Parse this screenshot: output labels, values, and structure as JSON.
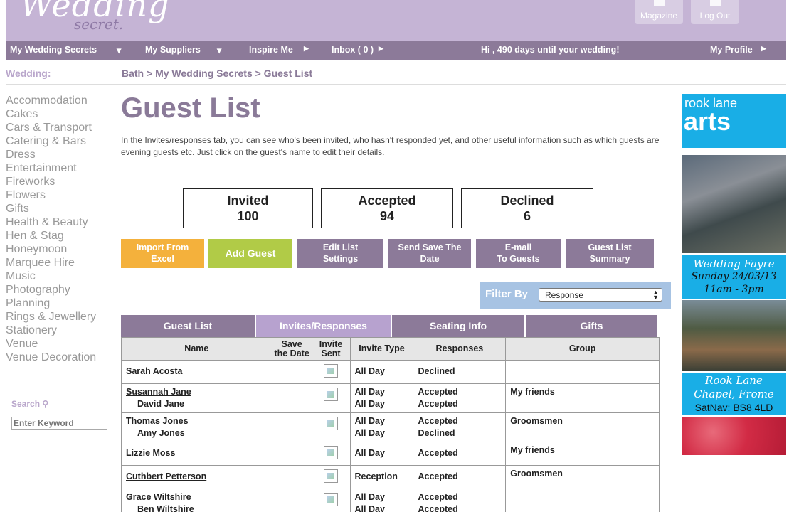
{
  "header": {
    "logo_main": "Wedding",
    "logo_sub": "secret.",
    "magazine": "Magazine",
    "logout": "Log Out"
  },
  "nav": {
    "my_wedding_secrets": "My Wedding Secrets",
    "my_suppliers": "My Suppliers",
    "inspire_me": "Inspire Me",
    "inbox": "Inbox ( 0 )",
    "greeting": "Hi , 490 days until your wedding!",
    "my_profile": "My Profile"
  },
  "sidebar": {
    "wedding_label": "Wedding:",
    "categories": [
      "Accommodation",
      "Cakes",
      "Cars & Transport",
      "Catering & Bars",
      "Dress",
      "Entertainment",
      "Fireworks",
      "Flowers",
      "Gifts",
      "Health & Beauty",
      "Hen & Stag",
      "Honeymoon",
      "Marquee Hire",
      "Music",
      "Photography",
      "Planning",
      "Rings & Jewellery",
      "Stationery",
      "Venue",
      "Venue Decoration"
    ],
    "search_label": "Search",
    "search_placeholder": "Enter Keyword"
  },
  "breadcrumb": "Bath > My Wedding Secrets > Guest List",
  "page": {
    "title": "Guest List",
    "intro": "In the Invites/responses tab, you can see who's been invited, who hasn't responded yet, and other useful information such as which guests are evening guests etc. Just click on the guest's name to edit their details."
  },
  "stats": {
    "invited_label": "Invited",
    "invited_value": "100",
    "accepted_label": "Accepted",
    "accepted_value": "94",
    "declined_label": "Declined",
    "declined_value": "6"
  },
  "actions": {
    "import_1": "Import From",
    "import_2": "Excel",
    "add_guest": "Add Guest",
    "edit_1": "Edit List",
    "edit_2": "Settings",
    "save_1": "Send Save The",
    "save_2": "Date",
    "email_1": "E-mail",
    "email_2": "To Guests",
    "summary_1": "Guest List",
    "summary_2": "Summary"
  },
  "filter": {
    "label": "Filter By",
    "selected": "Response"
  },
  "tabs": {
    "guest_list": "Guest List",
    "invites": "Invites/Responses",
    "seating": "Seating Info",
    "gifts": "Gifts"
  },
  "table": {
    "h_name": "Name",
    "h_save_1": "Save",
    "h_save_2": "the Date",
    "h_invite_1": "Invite",
    "h_invite_2": "Sent",
    "h_type": "Invite Type",
    "h_resp": "Responses",
    "h_group": "Group",
    "rows": [
      {
        "name1": "Sarah Acosta",
        "name2": "",
        "type1": "All Day",
        "type2": "",
        "resp1": "Declined",
        "resp2": "",
        "group": ""
      },
      {
        "name1": "Susannah Jane",
        "name2": "David Jane",
        "type1": "All Day",
        "type2": "All Day",
        "resp1": "Accepted",
        "resp2": "Accepted",
        "group": "My friends"
      },
      {
        "name1": "Thomas Jones",
        "name2": "Amy Jones",
        "type1": "All Day",
        "type2": "All Day",
        "resp1": "Accepted",
        "resp2": "Declined",
        "group": "Groomsmen"
      },
      {
        "name1": "Lizzie Moss",
        "name2": "",
        "type1": "All Day",
        "type2": "",
        "resp1": "Accepted",
        "resp2": "",
        "group": "My friends"
      },
      {
        "name1": "Cuthbert Petterson",
        "name2": "",
        "type1": "Reception",
        "type2": "",
        "resp1": "Accepted",
        "resp2": "",
        "group": "Groomsmen"
      },
      {
        "name1": "Grace Wiltshire",
        "name2": "Ben Wiltshire",
        "type1": "All Day",
        "type2": "All Day",
        "resp1": "Accepted",
        "resp2": "Accepted",
        "group": ""
      }
    ]
  },
  "ad": {
    "brand_1": "rook lane",
    "brand_2": "arts",
    "fayre_1": "Wedding Fayre",
    "fayre_2": "Sunday 24/03/13",
    "fayre_3": "11am - 3pm",
    "venue_1": "Rook Lane",
    "venue_2": "Chapel, Frome",
    "venue_3": "SatNav: BS8 4LD"
  }
}
